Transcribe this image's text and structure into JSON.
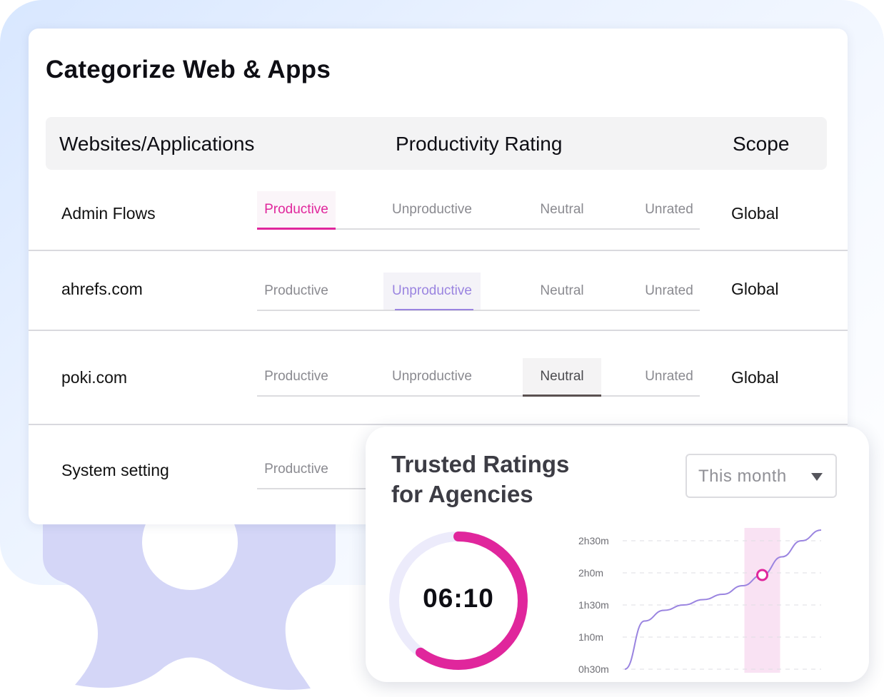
{
  "main_card": {
    "title": "Categorize Web & Apps",
    "columns": [
      "Websites/Applications",
      "Productivity Rating",
      "Scope"
    ],
    "rating_options": [
      "Productive",
      "Unproductive",
      "Neutral",
      "Unrated"
    ],
    "rows": [
      {
        "name": "Admin Flows",
        "selected": "Productive",
        "scope": "Global"
      },
      {
        "name": "ahrefs.com",
        "selected": "Unproductive",
        "scope": "Global"
      },
      {
        "name": "poki.com",
        "selected": "Neutral",
        "scope": "Global"
      },
      {
        "name": "System setting",
        "selected": "",
        "scope": ""
      }
    ]
  },
  "trusted_card": {
    "title_line1": "Trusted Ratings",
    "title_line2": "for Agencies",
    "period": "This month",
    "timer": "06:10",
    "progress": 0.6
  },
  "chart_data": {
    "type": "line",
    "y_tick_labels": [
      "2h30m",
      "2h0m",
      "1h30m",
      "1h0m",
      "0h30m"
    ],
    "ylim_minutes": [
      30,
      150
    ],
    "series": [
      {
        "x": [
          0,
          1,
          2,
          3,
          4,
          5,
          6,
          7,
          8,
          9,
          10
        ],
        "y": [
          30,
          75,
          85,
          90,
          95,
          100,
          108,
          118,
          135,
          150,
          160
        ]
      }
    ],
    "highlight_x": 7,
    "colors": {
      "line": "#9a84e0",
      "highlight": "#f9e2f3",
      "marker": "#e0269c"
    }
  },
  "colors": {
    "accent": "#e0269c",
    "purple": "#9a84e0",
    "gear": "#d4d6f7"
  }
}
